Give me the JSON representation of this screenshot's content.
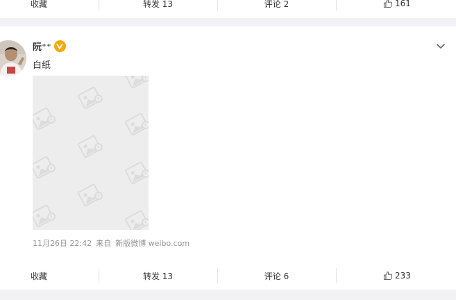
{
  "prev_post_actions": {
    "favorite_label": "收藏",
    "repost_label": "转发 13",
    "comment_label": "评论 2",
    "like_count": "161"
  },
  "post": {
    "username": "阮⁺⁺",
    "text": "白纸",
    "timestamp": "11月26日 22:42",
    "source_prefix": "来自",
    "source": "新版微博 weibo.com",
    "verified_badge_color": "#f6a700"
  },
  "post_actions": {
    "favorite_label": "收藏",
    "repost_label": "转发 13",
    "comment_label": "评论 6",
    "like_count": "233"
  },
  "icons": {
    "verified": "verified-v-icon",
    "menu": "chevron-down-icon",
    "like": "thumbs-up-icon",
    "image_placeholder": "image-placeholder-icon"
  }
}
